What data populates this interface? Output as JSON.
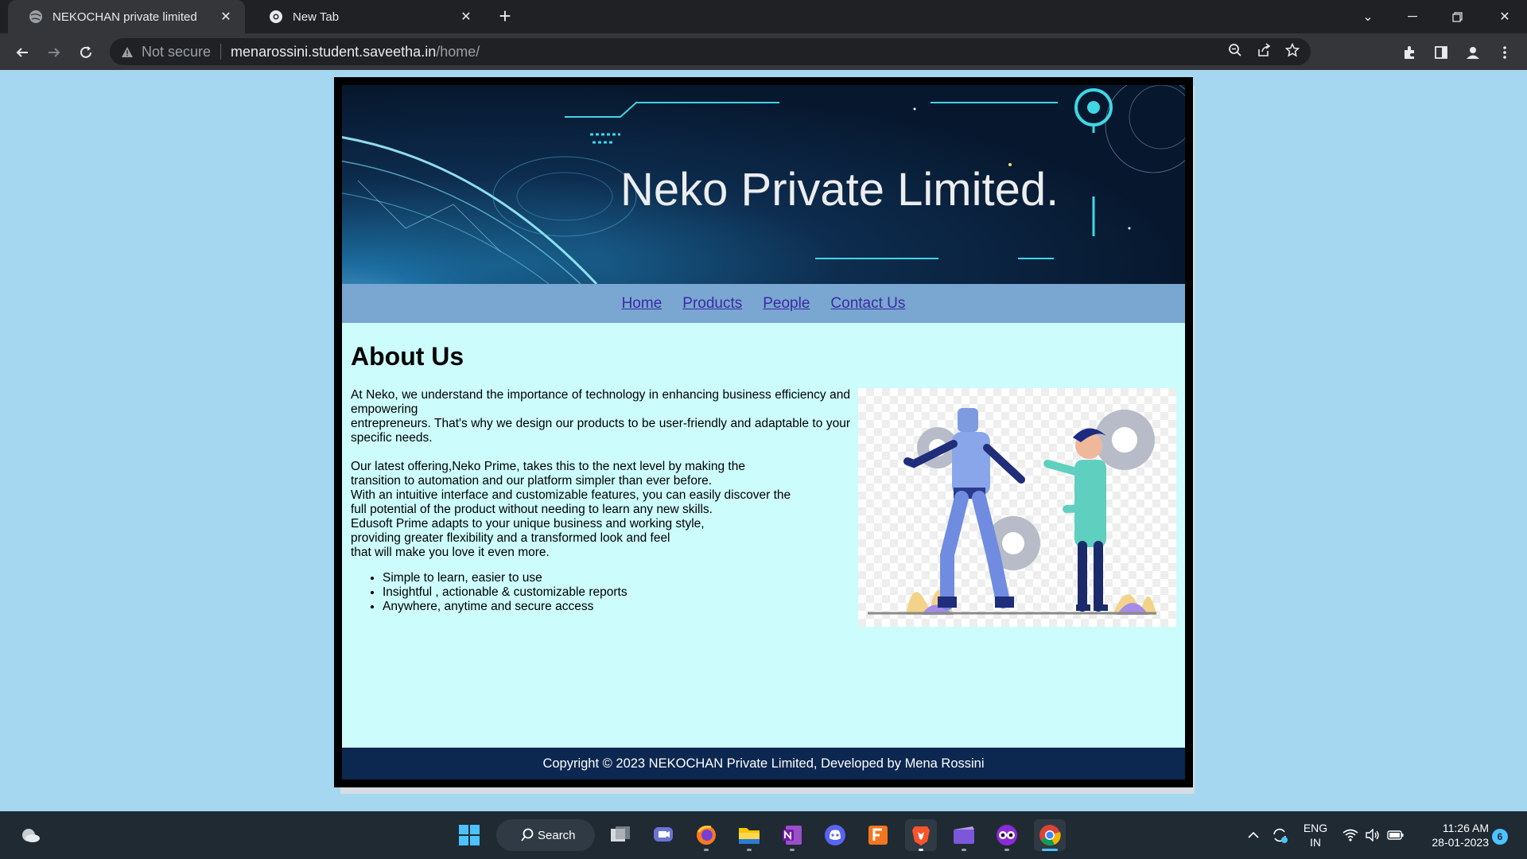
{
  "browser": {
    "tabs": [
      {
        "title": "NEKOCHAN private limited",
        "active": true
      },
      {
        "title": "New Tab",
        "active": false
      }
    ],
    "new_tab_symbol": "+",
    "address": {
      "security_label": "Not secure",
      "url_host": "menarossini.student.saveetha.in",
      "url_path": "/home/"
    }
  },
  "site": {
    "banner_title": "Neko Private Limited.",
    "nav": [
      "Home",
      "Products",
      "People",
      "Contact Us"
    ],
    "about_heading": "About Us",
    "para1_lines": [
      "At Neko, we understand the importance of technology in enhancing business efficiency and empowering",
      "entrepreneurs. That's why we design our products to be user-friendly and adaptable to your specific needs."
    ],
    "para2_lines": [
      "Our latest offering,Neko Prime, takes this to the next level by making the",
      "transition to automation and our platform simpler than ever before.",
      "With an intuitive interface and customizable features, you can easily discover the",
      "full potential of the product without needing to learn any new skills.",
      "Edusoft Prime adapts to your unique business and working style,",
      "providing greater flexibility and a transformed look and feel",
      "that will make you love it even more."
    ],
    "features": [
      "Simple to learn, easier to use",
      "Insightful , actionable & customizable reports",
      "Anywhere, anytime and secure access"
    ],
    "footer": "Copyright © 2023 NEKOCHAN Private Limited, Developed by Mena Rossini"
  },
  "taskbar": {
    "search_label": "Search",
    "language": [
      "ENG",
      "IN"
    ],
    "time": "11:26 AM",
    "date": "28-01-2023",
    "notification_count": "6"
  },
  "colors": {
    "background": "#a5d8f0",
    "nav_bar": "#7aa7d1",
    "content": "#ccfcfc",
    "footer": "#0c2850",
    "link": "#3a2aa3"
  }
}
